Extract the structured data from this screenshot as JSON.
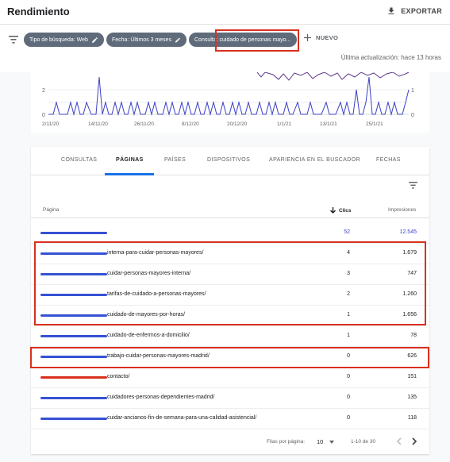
{
  "header": {
    "title": "Rendimiento",
    "export_label": "EXPORTAR"
  },
  "filters": {
    "chips": [
      "Tipo de búsqueda: Web",
      "Fecha: Últimos 3 meses",
      "Consulta: cuidado de personas mayo..."
    ],
    "new_label": "NUEVO",
    "updated_text": "Última actualización: hace 13 horas"
  },
  "chart": {
    "left_axis_ticks": [
      "2",
      "0"
    ],
    "right_axis_ticks": [
      "1",
      "0"
    ],
    "x_labels": [
      "2/11/20",
      "14/11/20",
      "26/11/20",
      "8/12/20",
      "20/12/20",
      "1/1/21",
      "13/1/21",
      "25/1/21"
    ]
  },
  "tabs": [
    "CONSULTAS",
    "PÁGINAS",
    "PAÍSES",
    "DISPOSITIVOS",
    "APARIENCIA EN EL BUSCADOR",
    "FECHAS"
  ],
  "table": {
    "columns": {
      "page": "Página",
      "clicks": "Clics",
      "impressions": "Impresiones"
    },
    "total": {
      "clicks": "52",
      "impressions": "12.545"
    },
    "rows": [
      {
        "path": "interna-para-cuidar-personas-mayores/",
        "clicks": "4",
        "impressions": "1.679"
      },
      {
        "path": "cuidar-personas-mayores-interna/",
        "clicks": "3",
        "impressions": "747"
      },
      {
        "path": "tarifas-de-cuidado-a-personas-mayores/",
        "clicks": "2",
        "impressions": "1.260"
      },
      {
        "path": "cuidado-de-mayores-por-horas/",
        "clicks": "1",
        "impressions": "1.656"
      },
      {
        "path": "cuidado-de-enfermos-a-domicilio/",
        "clicks": "1",
        "impressions": "78"
      },
      {
        "path": "trabajo-cuidar-personas-mayores-madrid/",
        "clicks": "0",
        "impressions": "626"
      },
      {
        "path": "contacto/",
        "clicks": "0",
        "impressions": "151"
      },
      {
        "path": "cuidadores-personas-dependientes-madrid/",
        "clicks": "0",
        "impressions": "135"
      },
      {
        "path": "cuidar-ancianos-fin-de-semana-para-una-calidad-asistencial/",
        "clicks": "0",
        "impressions": "118"
      }
    ]
  },
  "pagination": {
    "rows_per_page_label": "Filas por página:",
    "rows_per_page_value": "10",
    "range": "1-10 de 30"
  },
  "colors": {
    "clicks_line": "#3c40c6",
    "impressions_line": "#5e3a8c",
    "highlight": "#d9301e",
    "tab_active": "#1a73e8"
  }
}
